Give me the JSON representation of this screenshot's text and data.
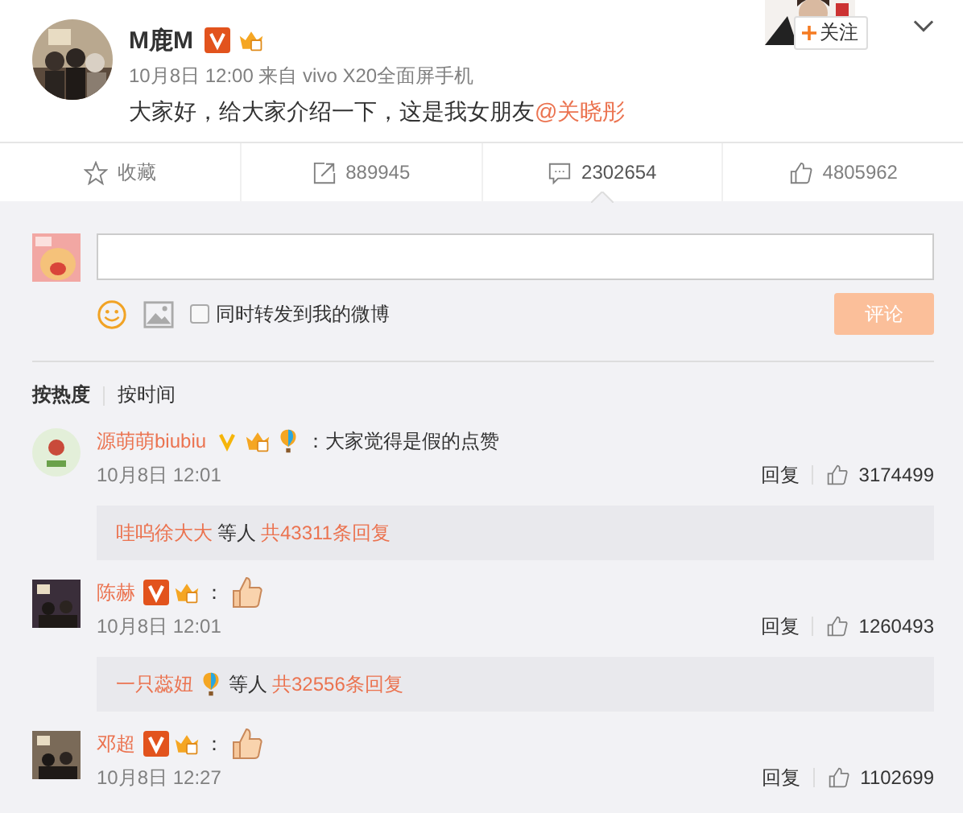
{
  "post": {
    "author": "M鹿M",
    "badges": [
      {
        "kind": "verified_red"
      },
      {
        "kind": "member"
      }
    ],
    "meta": "10月8日 12:00 来自 vivo X20全面屏手机",
    "text": "大家好，给大家介绍一下，这是我女朋友",
    "mention": "@关晓彤",
    "follow": "关注"
  },
  "actions": [
    {
      "kind": "favorite",
      "label": "收藏",
      "selected": false
    },
    {
      "kind": "repost",
      "label": "889945",
      "selected": false
    },
    {
      "kind": "comment",
      "label": "2302654",
      "selected": true
    },
    {
      "kind": "like",
      "label": "4805962",
      "selected": false
    }
  ],
  "composer": {
    "share_label": "同时转发到我的微博",
    "share_checked": false,
    "submit": "评论",
    "submit_disabled": true
  },
  "sort_tabs": [
    {
      "label": "按热度",
      "selected": true
    },
    {
      "label": "按时间",
      "selected": false
    }
  ],
  "comments": [
    {
      "name": "源萌萌biubiu",
      "badges": [
        {
          "kind": "verified_gold"
        },
        {
          "kind": "member"
        },
        {
          "kind": "balloon"
        }
      ],
      "text": "：大家觉得是假的点赞",
      "date": "10月8日 12:01",
      "reply": "回复",
      "likes": "3174499",
      "replies": {
        "names": [
          {
            "name": "哇呜徐大大"
          }
        ],
        "middle": "等人",
        "total": "共43311条回复"
      }
    },
    {
      "name": "陈赫",
      "badges": [
        {
          "kind": "verified_red"
        },
        {
          "kind": "member"
        }
      ],
      "text": "：",
      "sticker": {
        "kind": "thumbs_up"
      },
      "date": "10月8日 12:01",
      "reply": "回复",
      "likes": "1260493",
      "replies": {
        "names": [
          {
            "name": "一只蕊妞",
            "badges": [
              {
                "kind": "balloon"
              }
            ]
          }
        ],
        "middle": "等人",
        "total": "共32556条回复"
      }
    },
    {
      "name": "邓超",
      "badges": [
        {
          "kind": "verified_red"
        },
        {
          "kind": "member"
        }
      ],
      "text": "：",
      "sticker": {
        "kind": "thumbs_up"
      },
      "date": "10月8日 12:27",
      "reply": "回复",
      "likes": "1102699"
    }
  ]
}
